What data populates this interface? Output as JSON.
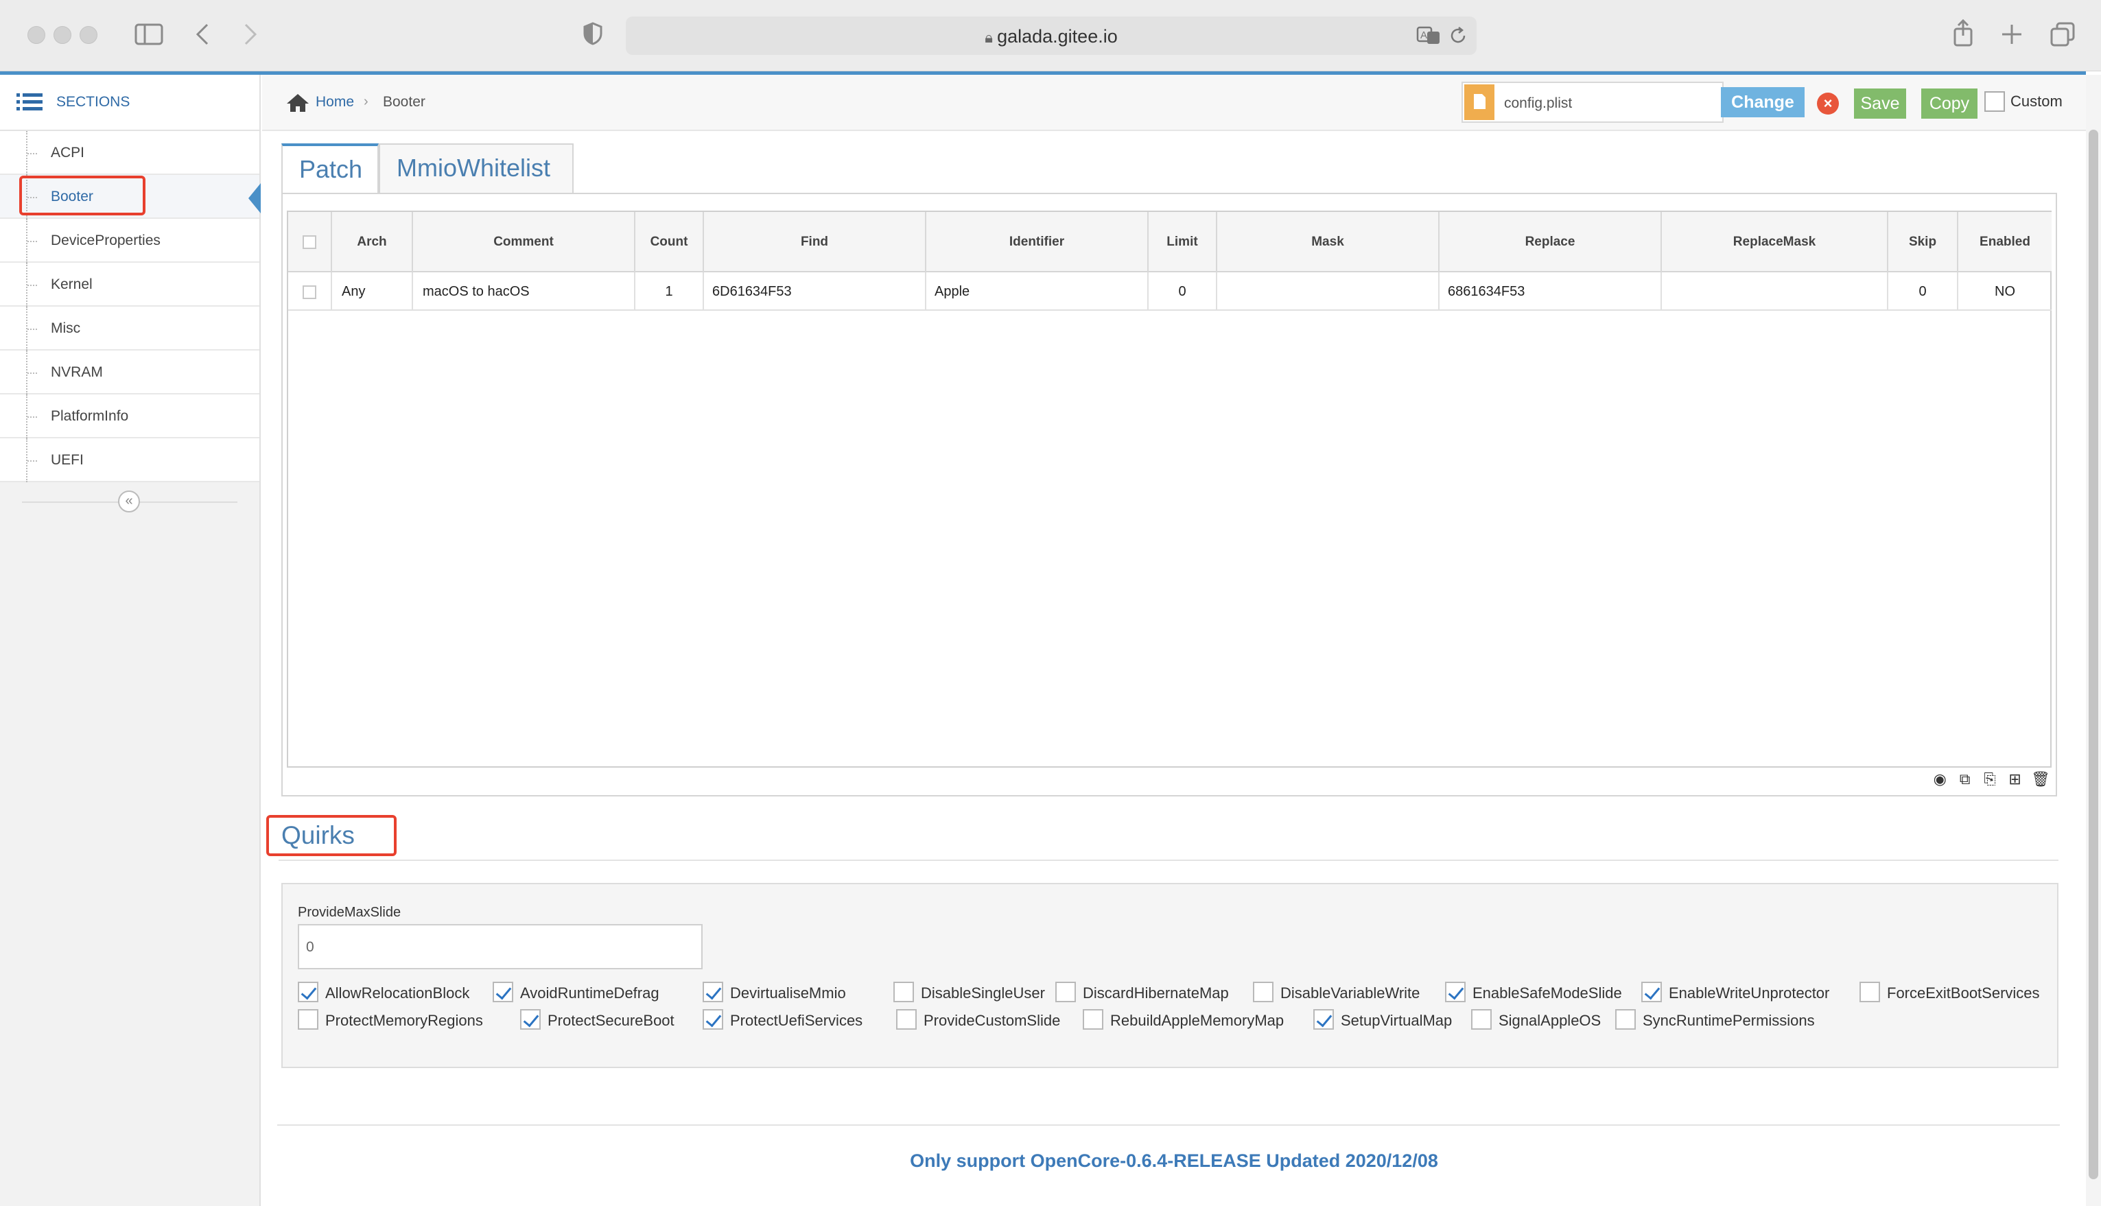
{
  "browser": {
    "url": "galada.gitee.io"
  },
  "sidebar": {
    "header": "SECTIONS",
    "items": [
      {
        "label": "ACPI"
      },
      {
        "label": "Booter"
      },
      {
        "label": "DeviceProperties"
      },
      {
        "label": "Kernel"
      },
      {
        "label": "Misc"
      },
      {
        "label": "NVRAM"
      },
      {
        "label": "PlatformInfo"
      },
      {
        "label": "UEFI"
      }
    ],
    "active_index": 1
  },
  "breadcrumb": {
    "home": "Home",
    "current": "Booter"
  },
  "toolbar": {
    "file_name": "config.plist",
    "change_label": "Change",
    "save_label": "Save",
    "copy_label": "Copy",
    "custom_label": "Custom"
  },
  "tabs": [
    {
      "label": "Patch",
      "active": true
    },
    {
      "label": "MmioWhitelist",
      "active": false
    }
  ],
  "patch_table": {
    "columns": [
      "Arch",
      "Comment",
      "Count",
      "Find",
      "Identifier",
      "Limit",
      "Mask",
      "Replace",
      "ReplaceMask",
      "Skip",
      "Enabled"
    ],
    "rows": [
      {
        "arch": "Any",
        "comment": "macOS to hacOS",
        "count": "1",
        "find": "6D61634F53",
        "identifier": "Apple",
        "limit": "0",
        "mask": "",
        "replace": "6861634F53",
        "replacemask": "",
        "skip": "0",
        "enabled": "NO"
      }
    ]
  },
  "quirks": {
    "title": "Quirks",
    "provide_max_slide_label": "ProvideMaxSlide",
    "provide_max_slide_value": "0",
    "items": [
      {
        "label": "AllowRelocationBlock",
        "checked": true
      },
      {
        "label": "AvoidRuntimeDefrag",
        "checked": true
      },
      {
        "label": "DevirtualiseMmio",
        "checked": true
      },
      {
        "label": "DisableSingleUser",
        "checked": false
      },
      {
        "label": "DiscardHibernateMap",
        "checked": false
      },
      {
        "label": "DisableVariableWrite",
        "checked": false
      },
      {
        "label": "EnableSafeModeSlide",
        "checked": true
      },
      {
        "label": "EnableWriteUnprotector",
        "checked": true
      },
      {
        "label": "ForceExitBootServices",
        "checked": false
      },
      {
        "label": "ProtectMemoryRegions",
        "checked": false
      },
      {
        "label": "ProtectSecureBoot",
        "checked": true
      },
      {
        "label": "ProtectUefiServices",
        "checked": true
      },
      {
        "label": "ProvideCustomSlide",
        "checked": false
      },
      {
        "label": "RebuildAppleMemoryMap",
        "checked": false
      },
      {
        "label": "SetupVirtualMap",
        "checked": true
      },
      {
        "label": "SignalAppleOS",
        "checked": false
      },
      {
        "label": "SyncRuntimePermissions",
        "checked": false
      }
    ]
  },
  "footer": {
    "text": "Only support OpenCore-0.6.4-RELEASE Updated 2020/12/08"
  },
  "colors": {
    "accent": "#4a90c8",
    "link": "#2f6aa6",
    "save": "#82bb6b",
    "highlight_box": "#e8402e"
  }
}
